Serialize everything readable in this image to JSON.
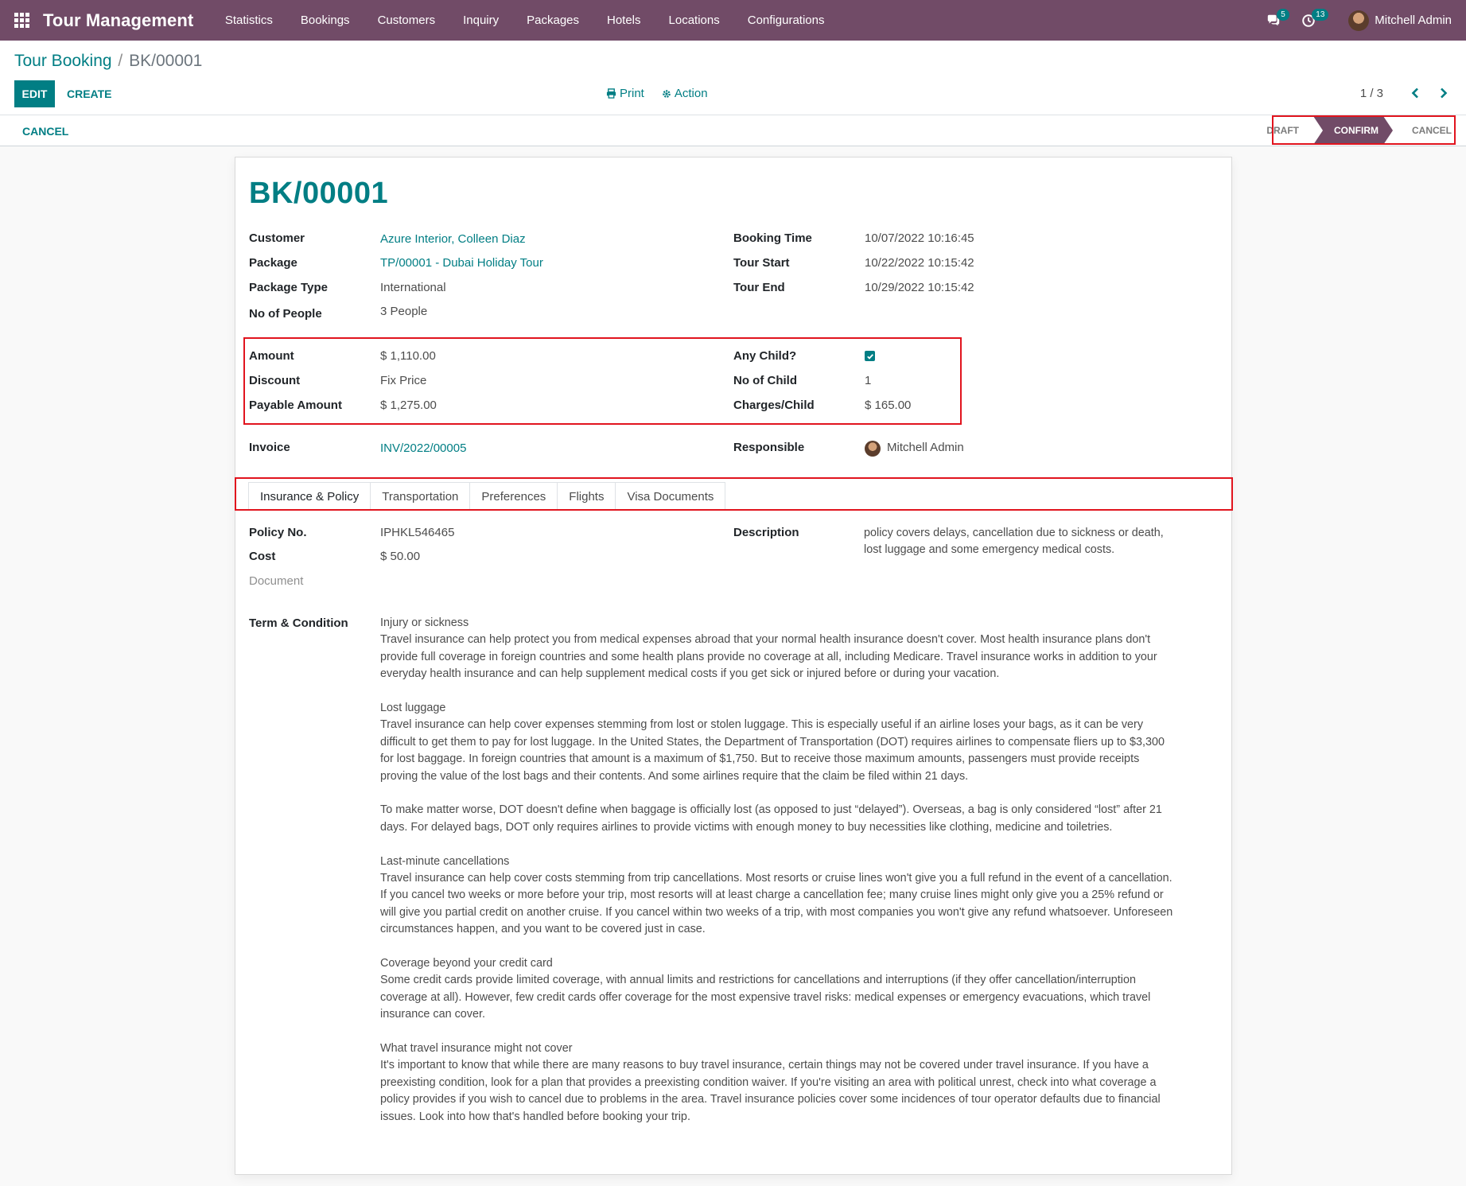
{
  "navbar": {
    "app_name": "Tour Management",
    "menu": [
      "Statistics",
      "Bookings",
      "Customers",
      "Inquiry",
      "Packages",
      "Hotels",
      "Locations",
      "Configurations"
    ],
    "messages_badge": "5",
    "activities_badge": "13",
    "user_name": "Mitchell Admin"
  },
  "breadcrumb": {
    "parent": "Tour Booking",
    "separator": "/",
    "current": "BK/00001"
  },
  "control_panel": {
    "edit_label": "EDIT",
    "create_label": "CREATE",
    "print_label": "Print",
    "action_label": "Action",
    "pager": "1 / 3"
  },
  "statusbar": {
    "cancel_button": "CANCEL",
    "stages": [
      "DRAFT",
      "CONFIRM",
      "CANCEL"
    ],
    "active_stage": "CONFIRM"
  },
  "record": {
    "title": "BK/00001",
    "left_fields": [
      {
        "label": "Customer",
        "value": "Azure Interior, Colleen Diaz",
        "link": true
      },
      {
        "label": "Package",
        "value": "TP/00001 - Dubai Holiday Tour",
        "link": true
      },
      {
        "label": "Package Type",
        "value": "International",
        "link": false
      },
      {
        "label": "No of People",
        "value": "3 People",
        "link": false
      }
    ],
    "right_fields": [
      {
        "label": "Booking Time",
        "value": "10/07/2022 10:16:45"
      },
      {
        "label": "Tour Start",
        "value": "10/22/2022 10:15:42"
      },
      {
        "label": "Tour End",
        "value": "10/29/2022 10:15:42"
      }
    ],
    "amount_fields": [
      {
        "label": "Amount",
        "value": "$ 1,110.00"
      },
      {
        "label": "Discount",
        "value": "Fix Price"
      },
      {
        "label": "Payable Amount",
        "value": "$ 1,275.00"
      }
    ],
    "child_fields": {
      "any_child_label": "Any Child?",
      "any_child_checked": true,
      "no_of_child_label": "No of Child",
      "no_of_child_value": "1",
      "charges_label": "Charges/Child",
      "charges_value": "$ 165.00"
    },
    "invoice_label": "Invoice",
    "invoice_value": "INV/2022/00005",
    "responsible_label": "Responsible",
    "responsible_value": "Mitchell Admin"
  },
  "tabs": [
    "Insurance & Policy",
    "Transportation",
    "Preferences",
    "Flights",
    "Visa Documents"
  ],
  "active_tab": "Insurance & Policy",
  "insurance": {
    "policy_label": "Policy No.",
    "policy_value": "IPHKL546465",
    "cost_label": "Cost",
    "cost_value": "$ 50.00",
    "document_label": "Document",
    "description_label": "Description",
    "description_value": "policy covers delays, cancellation due to sickness or death, lost luggage and some emergency medical costs.",
    "terms_label": "Term & Condition",
    "terms": [
      [
        "Injury or sickness",
        "Travel insurance can help protect you from medical expenses abroad that your normal health insurance doesn't cover. Most health insurance plans don't provide full coverage in foreign countries and some health plans provide no coverage at all, including Medicare. Travel insurance works in addition to your everyday health insurance and can help supplement medical costs if you get sick or injured before or during your vacation."
      ],
      [
        "Lost luggage",
        "Travel insurance can help cover expenses stemming from lost or stolen luggage. This is especially useful if an airline loses your bags, as it can be very difficult to get them to pay for lost luggage. In the United States, the Department of Transportation (DOT) requires airlines to compensate fliers up to $3,300 for lost baggage. In foreign countries that amount is a maximum of $1,750. But to receive those maximum amounts, passengers must provide receipts proving the value of the lost bags and their contents. And some airlines require that the claim be filed within 21 days."
      ],
      [
        "",
        "To make matter worse, DOT doesn't define when baggage is officially lost (as opposed to just “delayed”). Overseas, a bag is only considered “lost” after 21 days. For delayed bags, DOT only requires airlines to provide victims with enough money to buy necessities like clothing, medicine and toiletries."
      ],
      [
        "Last-minute cancellations",
        "Travel insurance can help cover costs stemming from trip cancellations. Most resorts or cruise lines won't give you a full refund in the event of a cancellation. If you cancel two weeks or more before your trip, most resorts will at least charge a cancellation fee; many cruise lines might only give you a 25% refund or will give you partial credit on another cruise. If you cancel within two weeks of a trip, with most companies you won't give any refund whatsoever. Unforeseen circumstances happen, and you want to be covered just in case."
      ],
      [
        "Coverage beyond your credit card",
        "Some credit cards provide limited coverage, with annual limits and restrictions for cancellations and interruptions (if they offer cancellation/interruption coverage at all). However, few credit cards offer coverage for the most expensive travel risks: medical expenses or emergency evacuations, which travel insurance can cover."
      ],
      [
        "What travel insurance might not cover",
        "It's important to know that while there are many reasons to buy travel insurance, certain things may not be covered under travel insurance. If you have a preexisting condition, look for a plan that provides a preexisting condition waiver. If you're visiting an area with political unrest, check into what coverage a policy provides if you wish to cancel due to problems in the area. Travel insurance policies cover some incidences of tour operator defaults due to financial issues. Look into how that's handled before booking your trip."
      ]
    ]
  },
  "colors": {
    "navbar": "#714b67",
    "accent": "#017e84",
    "highlight": "#e1141e"
  }
}
